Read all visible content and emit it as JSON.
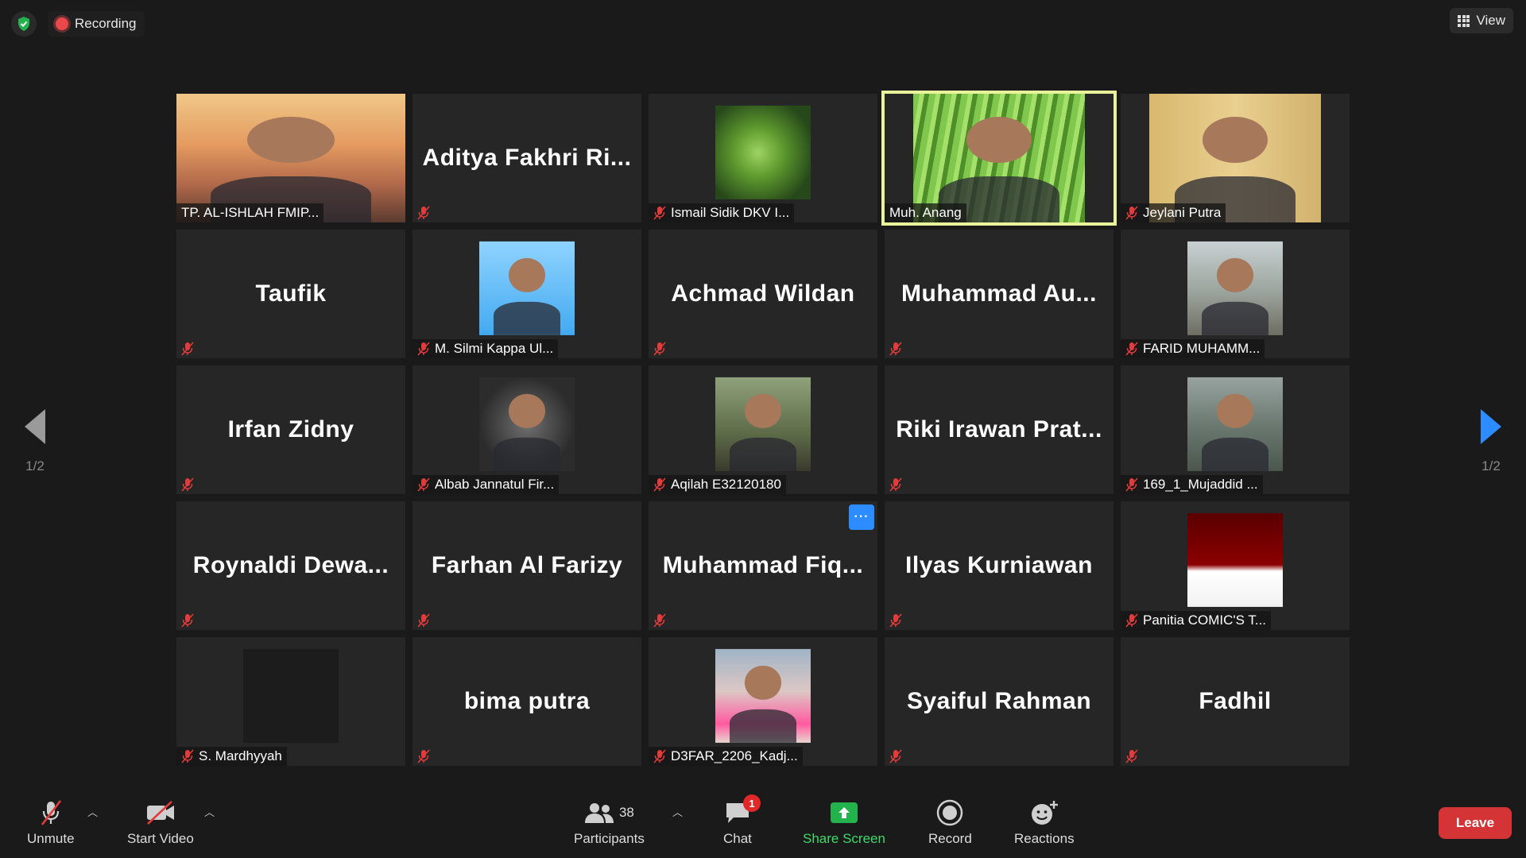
{
  "top": {
    "recording_label": "Recording",
    "view_label": "View"
  },
  "pager": {
    "left_page": "1/2",
    "right_page": "1/2"
  },
  "colors": {
    "active_speaker": "#e9f49a",
    "accent": "#2d8cff",
    "leave": "#d53436",
    "share": "#3fd96a",
    "muted": "#e8484a"
  },
  "tiles": [
    {
      "name": "TP. AL-ISHLAH FMIP...",
      "muted": false,
      "video": "bridge-photo",
      "big_name": ""
    },
    {
      "name": "",
      "muted": true,
      "video": "",
      "big_name": "Aditya Fakhri Ri..."
    },
    {
      "name": "Ismail Sidik DKV I...",
      "muted": true,
      "video": "leaf-photo",
      "big_name": ""
    },
    {
      "name": "Muh. Anang",
      "muted": false,
      "video": "grass-photo",
      "big_name": "",
      "active": true
    },
    {
      "name": "Jeylani Putra",
      "muted": true,
      "video": "wall-photo",
      "big_name": ""
    },
    {
      "name": "",
      "muted": true,
      "video": "",
      "big_name": "Taufik"
    },
    {
      "name": "M. Silmi Kappa Ul...",
      "muted": true,
      "video": "sky-photo",
      "big_name": ""
    },
    {
      "name": "",
      "muted": true,
      "video": "",
      "big_name": "Achmad Wildan"
    },
    {
      "name": "",
      "muted": true,
      "video": "",
      "big_name": "Muhammad Au..."
    },
    {
      "name": "FARID MUHAMM...",
      "muted": true,
      "video": "city-photo",
      "big_name": ""
    },
    {
      "name": "",
      "muted": true,
      "video": "",
      "big_name": "Irfan Zidny"
    },
    {
      "name": "Albab Jannatul Fir...",
      "muted": true,
      "video": "dark-photo",
      "big_name": ""
    },
    {
      "name": "Aqilah E32120180",
      "muted": true,
      "video": "forest-photo",
      "big_name": ""
    },
    {
      "name": "",
      "muted": true,
      "video": "",
      "big_name": "Riki Irawan Prat..."
    },
    {
      "name": "169_1_Mujaddid ...",
      "muted": true,
      "video": "hill-photo",
      "big_name": ""
    },
    {
      "name": "",
      "muted": true,
      "video": "",
      "big_name": "Roynaldi Dewa..."
    },
    {
      "name": "",
      "muted": true,
      "video": "",
      "big_name": "Farhan Al Farizy"
    },
    {
      "name": "",
      "muted": true,
      "video": "",
      "big_name": "Muhammad Fiq...",
      "more": "···"
    },
    {
      "name": "",
      "muted": true,
      "video": "",
      "big_name": "Ilyas Kurniawan"
    },
    {
      "name": "Panitia COMIC'S T...",
      "muted": true,
      "video": "red-photo",
      "big_name": ""
    },
    {
      "name": "S. Mardhyyah",
      "muted": true,
      "video": "black-photo",
      "big_name": ""
    },
    {
      "name": "",
      "muted": true,
      "video": "",
      "big_name": "bima putra"
    },
    {
      "name": "D3FAR_2206_Kadj...",
      "muted": true,
      "video": "girl-photo",
      "big_name": ""
    },
    {
      "name": "",
      "muted": true,
      "video": "",
      "big_name": "Syaiful Rahman"
    },
    {
      "name": "",
      "muted": true,
      "video": "",
      "big_name": "Fadhil"
    }
  ],
  "toolbar": {
    "unmute": "Unmute",
    "start_video": "Start Video",
    "participants": "Participants",
    "participants_count": "38",
    "chat": "Chat",
    "chat_badge": "1",
    "share_screen": "Share Screen",
    "record": "Record",
    "reactions": "Reactions",
    "leave": "Leave"
  }
}
